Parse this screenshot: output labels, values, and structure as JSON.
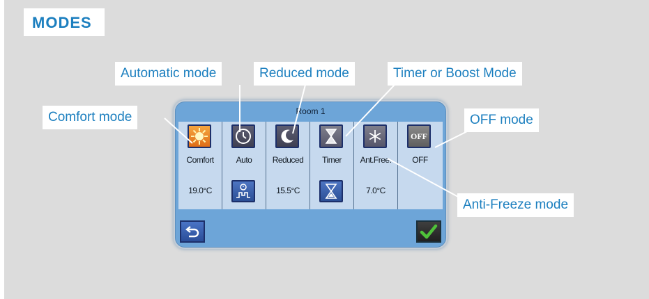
{
  "section_title": "MODES",
  "device": {
    "title": "Room 1",
    "modes": [
      {
        "label": "Comfort",
        "value": "19.0°C",
        "icon": "sun-icon"
      },
      {
        "label": "Auto",
        "value": "",
        "icon": "clock-icon",
        "sub_icon": "schedule-icon"
      },
      {
        "label": "Reduced",
        "value": "15.5°C",
        "icon": "moon-icon"
      },
      {
        "label": "Timer",
        "value": "",
        "icon": "hourglass-icon",
        "sub_icon": "hourglass-icon"
      },
      {
        "label": "Ant.Free.",
        "value": "7.0°C",
        "icon": "snowflake-icon"
      },
      {
        "label": "OFF",
        "value": "",
        "icon": "off-icon",
        "icon_text": "OFF"
      }
    ],
    "back_icon": "back-arrow-icon",
    "confirm_icon": "checkmark-icon"
  },
  "callouts": {
    "comfort": "Comfort mode",
    "automatic": "Automatic mode",
    "reduced": "Reduced mode",
    "timer": "Timer or Boost Mode",
    "off": "OFF mode",
    "antifreeze": "Anti-Freeze mode"
  },
  "colors": {
    "accent": "#1c7fbf",
    "panel_bg": "#dcdcdc",
    "screen_frame": "#6da5d8",
    "screen_content": "#c6d9ee"
  }
}
